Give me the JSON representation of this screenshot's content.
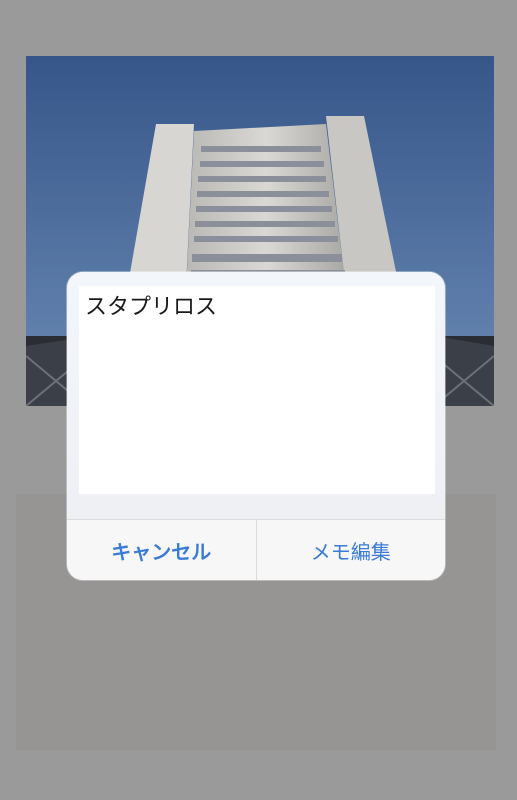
{
  "photo": {
    "subject": "building-photo"
  },
  "dialog": {
    "memo_text": "スタプリロス",
    "buttons": {
      "cancel_label": "キャンセル",
      "edit_memo_label": "メモ編集"
    }
  },
  "colors": {
    "accent": "#3a7bd5",
    "overlay": "#9a9a9a",
    "dialog_bg": "#f7f7f7"
  }
}
